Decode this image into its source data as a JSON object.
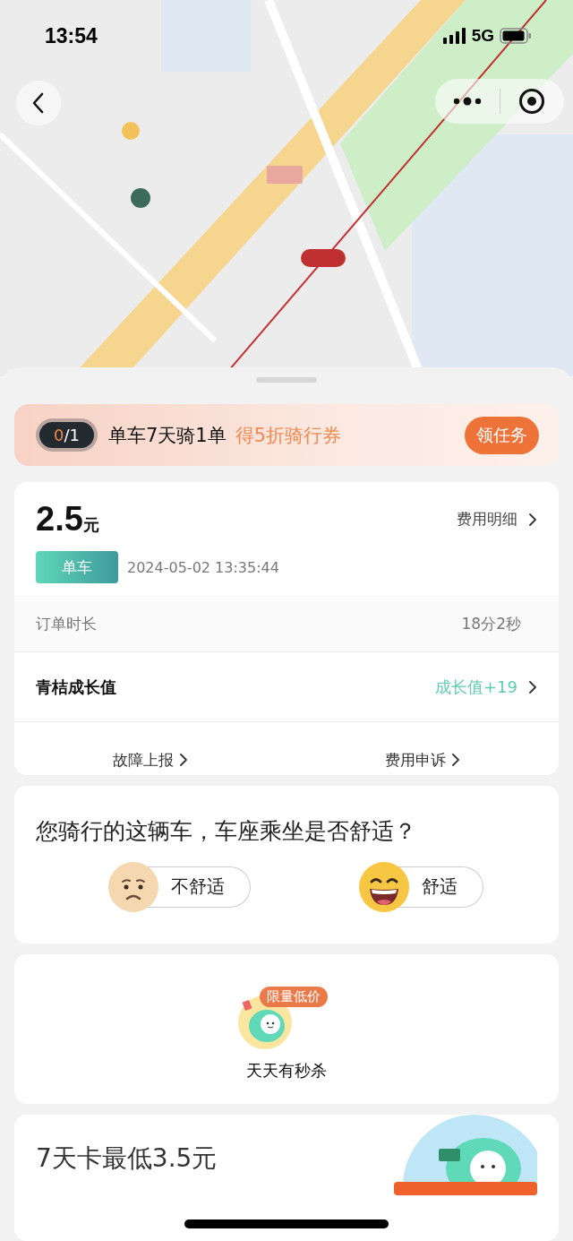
{
  "status_bar": {
    "time": "13:54",
    "network": "5G"
  },
  "task": {
    "level": 0,
    "progress_done": "0",
    "progress_total": "/1",
    "title": "单车7天骑1单",
    "reward": "得5折骑行券",
    "button": "领任务"
  },
  "order": {
    "price": "2.5",
    "unit": "元",
    "detail_link": "费用明细",
    "vehicle_tag": "单车",
    "time": "2024-05-02 13:35:44",
    "duration_label": "订单时长",
    "duration": "18分2秒",
    "growth_label": "青桔成长值",
    "growth_value": "成长值+19",
    "actions": [
      "故障上报",
      "费用申诉"
    ]
  },
  "survey": {
    "question": "您骑行的这辆车，车座乘坐是否舒适？",
    "options": [
      {
        "label": "不舒适",
        "kind": "sad"
      },
      {
        "label": "舒适",
        "kind": "happy"
      }
    ]
  },
  "promo": {
    "badge": "限量低价",
    "label": "天天有秒杀"
  },
  "card_promo": {
    "title": "7天卡最低3.5元"
  }
}
